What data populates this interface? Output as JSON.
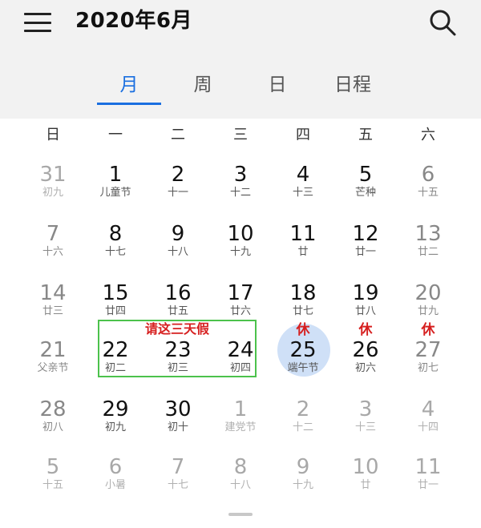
{
  "header": {
    "title": "2020年6月"
  },
  "tabs": [
    {
      "label": "月",
      "active": true
    },
    {
      "label": "周",
      "active": false
    },
    {
      "label": "日",
      "active": false
    },
    {
      "label": "日程",
      "active": false
    }
  ],
  "weekdays": [
    "日",
    "一",
    "二",
    "三",
    "四",
    "五",
    "六"
  ],
  "weeks": [
    [
      {
        "n": "31",
        "s": "初九",
        "muted": true
      },
      {
        "n": "1",
        "s": "儿童节"
      },
      {
        "n": "2",
        "s": "十一"
      },
      {
        "n": "3",
        "s": "十二"
      },
      {
        "n": "4",
        "s": "十三"
      },
      {
        "n": "5",
        "s": "芒种"
      },
      {
        "n": "6",
        "s": "十五",
        "weekend": true
      }
    ],
    [
      {
        "n": "7",
        "s": "十六",
        "weekend": true
      },
      {
        "n": "8",
        "s": "十七"
      },
      {
        "n": "9",
        "s": "十八"
      },
      {
        "n": "10",
        "s": "十九"
      },
      {
        "n": "11",
        "s": "廿"
      },
      {
        "n": "12",
        "s": "廿一"
      },
      {
        "n": "13",
        "s": "廿二",
        "weekend": true
      }
    ],
    [
      {
        "n": "14",
        "s": "廿三",
        "weekend": true
      },
      {
        "n": "15",
        "s": "廿四"
      },
      {
        "n": "16",
        "s": "廿五"
      },
      {
        "n": "17",
        "s": "廿六"
      },
      {
        "n": "18",
        "s": "廿七"
      },
      {
        "n": "19",
        "s": "廿八"
      },
      {
        "n": "20",
        "s": "廿九",
        "weekend": true
      }
    ],
    [
      {
        "n": "21",
        "s": "父亲节",
        "weekend": true
      },
      {
        "n": "22",
        "s": "初二"
      },
      {
        "n": "23",
        "s": "初三"
      },
      {
        "n": "24",
        "s": "初四"
      },
      {
        "n": "25",
        "s": "端午节"
      },
      {
        "n": "26",
        "s": "初六"
      },
      {
        "n": "27",
        "s": "初七",
        "weekend": true
      }
    ],
    [
      {
        "n": "28",
        "s": "初八",
        "weekend": true
      },
      {
        "n": "29",
        "s": "初九"
      },
      {
        "n": "30",
        "s": "初十"
      },
      {
        "n": "1",
        "s": "建党节",
        "muted": true
      },
      {
        "n": "2",
        "s": "十二",
        "muted": true
      },
      {
        "n": "3",
        "s": "十三",
        "muted": true
      },
      {
        "n": "4",
        "s": "十四",
        "muted": true
      }
    ],
    [
      {
        "n": "5",
        "s": "十五",
        "muted": true
      },
      {
        "n": "6",
        "s": "小暑",
        "muted": true
      },
      {
        "n": "7",
        "s": "十七",
        "muted": true
      },
      {
        "n": "8",
        "s": "十八",
        "muted": true
      },
      {
        "n": "9",
        "s": "十九",
        "muted": true
      },
      {
        "n": "10",
        "s": "廿",
        "muted": true
      },
      {
        "n": "11",
        "s": "廿一",
        "muted": true
      }
    ]
  ],
  "annotations": {
    "request_label": "请这三天假",
    "rest_label": "休"
  },
  "colors": {
    "accent": "#1a6fe0",
    "today_circle": "#cfe0f7",
    "annotation_red": "#d61f1f",
    "annotation_box": "#4cc24c"
  }
}
